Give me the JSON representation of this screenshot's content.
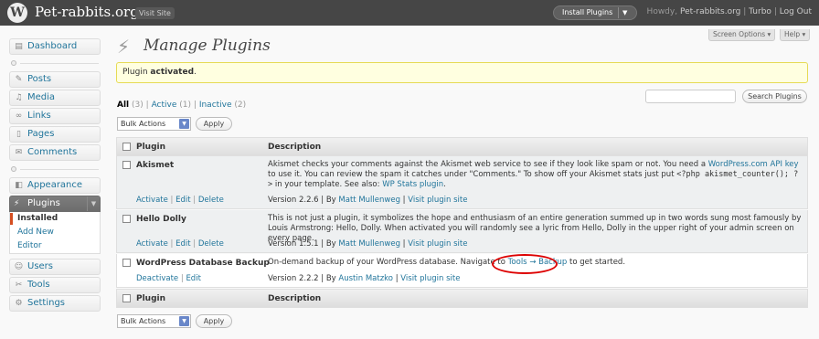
{
  "header": {
    "site_title": "Pet-rabbits.org",
    "visit_site": "Visit Site",
    "install_plugins": "Install Plugins",
    "howdy": "Howdy,",
    "user": "Pet-rabbits.org",
    "turbo": "Turbo",
    "logout": "Log Out",
    "sep": "|"
  },
  "sidebar": {
    "dashboard": "Dashboard",
    "posts": "Posts",
    "media": "Media",
    "links": "Links",
    "pages": "Pages",
    "comments": "Comments",
    "appearance": "Appearance",
    "plugins": "Plugins",
    "plugins_sub": [
      "Installed",
      "Add New",
      "Editor"
    ],
    "users": "Users",
    "tools": "Tools",
    "settings": "Settings"
  },
  "page": {
    "title": "Manage Plugins",
    "screen_options": "Screen Options",
    "help": "Help",
    "notice_prefix": "Plugin ",
    "notice_bold": "activated",
    "notice_suffix": "."
  },
  "filters": {
    "all": "All",
    "all_count": "(3)",
    "active": "Active",
    "active_count": "(1)",
    "inactive": "Inactive",
    "inactive_count": "(2)",
    "sep": "|"
  },
  "search_button": "Search Plugins",
  "bulk_actions": "Bulk Actions",
  "apply": "Apply",
  "table": {
    "col_plugin": "Plugin",
    "col_description": "Description"
  },
  "plugins": [
    {
      "name": "Akismet",
      "actions": [
        "Activate",
        "Edit",
        "Delete"
      ],
      "desc_1": "Akismet checks your comments against the Akismet web service to see if they look like spam or not. You need a ",
      "desc_link": "WordPress.com API key",
      "desc_2": " to use it. You can review the spam it catches under \"Comments.\" To show off your Akismet stats just put ",
      "desc_code": "<?php akismet_counter(); ?>",
      "desc_3": " in your template. See also: ",
      "desc_link2": "WP Stats plugin",
      "desc_4": ".",
      "version": "Version 2.2.6 | By ",
      "author": "Matt Mullenweg",
      "site": "Visit plugin site"
    },
    {
      "name": "Hello Dolly",
      "actions": [
        "Activate",
        "Edit",
        "Delete"
      ],
      "desc": "This is not just a plugin, it symbolizes the hope and enthusiasm of an entire generation summed up in two words sung most famously by Louis Armstrong: Hello, Dolly. When activated you will randomly see a lyric from Hello, Dolly in the upper right of your admin screen on every page.",
      "version": "Version 1.5.1 | By ",
      "author": "Matt Mullenweg",
      "site": "Visit plugin site"
    },
    {
      "name": "WordPress Database Backup",
      "actions": [
        "Deactivate",
        "Edit"
      ],
      "desc_1": "On-demand backup of your WordPress database. Navigate to ",
      "desc_link": "Tools → Backup",
      "desc_2": " to get started.",
      "version": "Version 2.2.2 | By ",
      "author": "Austin Matzko",
      "site": "Visit plugin site"
    }
  ],
  "colors": {
    "header_bg": "#464646",
    "link": "#21759b",
    "notice_bg": "#ffffe0",
    "highlight_circle": "#dd0000"
  }
}
